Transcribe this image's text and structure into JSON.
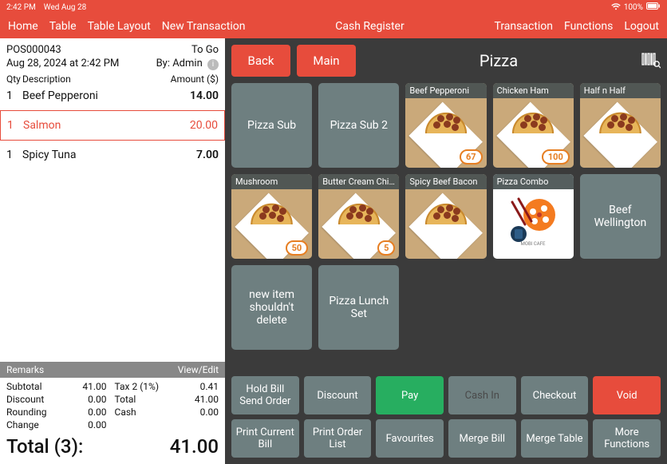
{
  "status": {
    "time": "2:42 PM",
    "date": "Wed Aug 28",
    "battery": "100%"
  },
  "menu": {
    "left": [
      "Home",
      "Table",
      "Table Layout",
      "New Transaction"
    ],
    "center": "Cash Register",
    "right": [
      "Transaction",
      "Functions",
      "Logout"
    ]
  },
  "order": {
    "id": "POS000043",
    "type": "To Go",
    "datetime": "Aug 28, 2024 at 2:42 PM",
    "by_label": "By: Admin",
    "columns": {
      "qty": "Qty",
      "desc": "Description",
      "amt": "Amount ($)"
    },
    "items": [
      {
        "qty": "1",
        "desc": "Beef Pepperoni",
        "amt": "14.00",
        "selected": false
      },
      {
        "qty": "1",
        "desc": "Salmon",
        "amt": "20.00",
        "selected": true
      },
      {
        "qty": "1",
        "desc": "Spicy Tuna",
        "amt": "7.00",
        "selected": false
      }
    ],
    "remarks_label": "Remarks",
    "view_edit_label": "View/Edit",
    "totals": {
      "subtotal_label": "Subtotal",
      "subtotal": "41.00",
      "discount_label": "Discount",
      "discount": "0.00",
      "rounding_label": "Rounding",
      "rounding": "0.00",
      "change_label": "Change",
      "change": "0.00",
      "tax_label": "Tax 2 (1%)",
      "tax": "0.41",
      "total_label": "Total",
      "total": "41.00",
      "cash_label": "Cash",
      "cash": "0.00"
    },
    "grand_total_label": "Total (3):",
    "grand_total": "41.00"
  },
  "catalog": {
    "back": "Back",
    "main": "Main",
    "title": "Pizza",
    "tiles": [
      {
        "kind": "text",
        "label": "Pizza Sub"
      },
      {
        "kind": "text",
        "label": "Pizza Sub 2"
      },
      {
        "kind": "image",
        "label": "Beef Pepperoni",
        "count": "67"
      },
      {
        "kind": "image",
        "label": "Chicken Ham",
        "count": "100"
      },
      {
        "kind": "image",
        "label": "Half n Half"
      },
      {
        "kind": "image",
        "label": "Mushroom",
        "count": "50"
      },
      {
        "kind": "image",
        "label": "Butter Cream Chick...",
        "count": "5"
      },
      {
        "kind": "image",
        "label": "Spicy Beef Bacon"
      },
      {
        "kind": "combo",
        "label": "Pizza Combo"
      },
      {
        "kind": "text",
        "label": "Beef Wellington"
      },
      {
        "kind": "text",
        "label": "new item shouldn't delete"
      },
      {
        "kind": "text",
        "label": "Pizza Lunch Set"
      }
    ]
  },
  "functions": {
    "row1": [
      {
        "label": "Hold Bill Send Order",
        "style": ""
      },
      {
        "label": "Discount",
        "style": ""
      },
      {
        "label": "Pay",
        "style": "green"
      },
      {
        "label": "Cash In",
        "style": "dim"
      },
      {
        "label": "Checkout",
        "style": ""
      },
      {
        "label": "Void",
        "style": "red"
      }
    ],
    "row2": [
      {
        "label": "Print Current Bill",
        "style": ""
      },
      {
        "label": "Print Order List",
        "style": ""
      },
      {
        "label": "Favourites",
        "style": ""
      },
      {
        "label": "Merge Bill",
        "style": ""
      },
      {
        "label": "Merge Table",
        "style": ""
      },
      {
        "label": "More Functions",
        "style": ""
      }
    ]
  }
}
